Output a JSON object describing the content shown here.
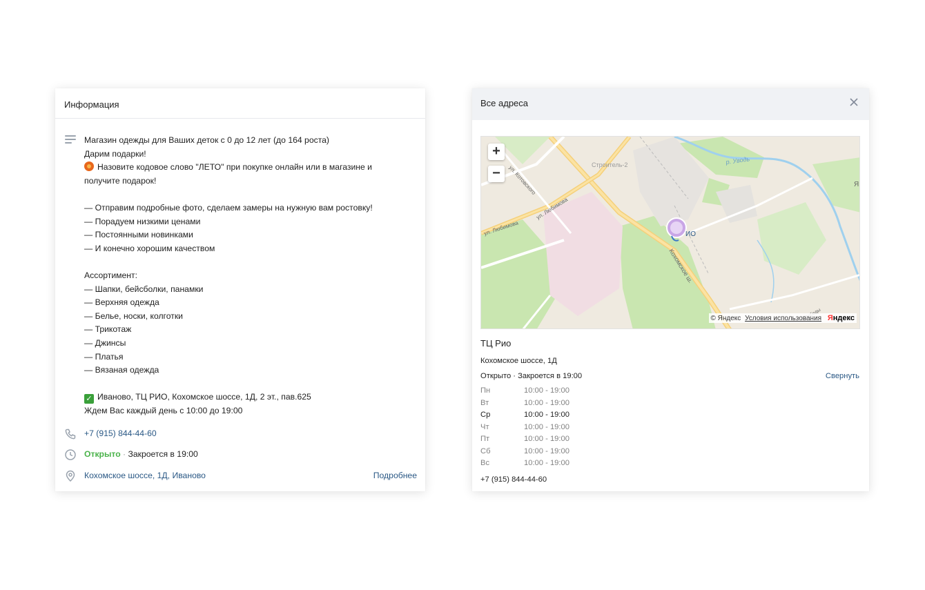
{
  "info": {
    "title": "Информация",
    "description_lines": [
      "Магазин одежды для Ваших деток с 0 до 12 лет (до 164 роста)",
      "Дарим подарки!",
      "Назовите кодовое слово \"ЛЕТО\" при покупке онлайн или в магазине и",
      "получите подарок!",
      "",
      "— Отправим подробные фото, сделаем замеры на нужную вам ростовку!",
      "— Порадуем низкими ценами",
      "— Постоянными новинками",
      "— И конечно хорошим качеством",
      "",
      "Ассортимент:",
      "— Шапки, бейсболки, панамки",
      "— Верхняя одежда",
      "— Белье, носки, колготки",
      "— Трикотаж",
      "— Джинсы",
      "— Платья",
      "— Вязаная одежда",
      "",
      "Иваново, ТЦ РИО, Кохомское шоссе, 1Д, 2 эт., пав.625",
      "Ждем Вас каждый день с 10:00 до 19:00"
    ],
    "phone": "+7 (915) 844-44-60",
    "status_open": "Открыто",
    "status_sep": "·",
    "status_close": "Закроется в 19:00",
    "address": "Кохомское шоссе, 1Д, Иваново",
    "more_label": "Подробнее"
  },
  "addresses": {
    "title": "Все адреса",
    "map": {
      "zoom_in": "+",
      "zoom_out": "−",
      "labels": {
        "stroitel": "Строитель-2",
        "uvod": "р. Уводь",
        "kotovskogo": "ул. Котовского",
        "lyubimova1": "ул. Любимова",
        "lyubimova2": "ул. Любимова",
        "kokhomskoe": "Кохомское ш.",
        "pobedy": "Победы",
        "rio": "ИО",
        "ya": "Я"
      },
      "copyright": "© Яндекс",
      "terms": "Условия использования",
      "brand_red": "Я",
      "brand_black": "ндекс"
    },
    "place": {
      "name": "ТЦ Рио",
      "address": "Кохомское шоссе, 1Д",
      "status": "Открыто · Закроется в 19:00",
      "collapse_label": "Свернуть",
      "schedule": [
        {
          "day": "Пн",
          "hours": "10:00 - 19:00"
        },
        {
          "day": "Вт",
          "hours": "10:00 - 19:00"
        },
        {
          "day": "Ср",
          "hours": "10:00 - 19:00"
        },
        {
          "day": "Чт",
          "hours": "10:00 - 19:00"
        },
        {
          "day": "Пт",
          "hours": "10:00 - 19:00"
        },
        {
          "day": "Сб",
          "hours": "10:00 - 19:00"
        },
        {
          "day": "Вс",
          "hours": "10:00 - 19:00"
        }
      ],
      "phone": "+7 (915) 844-44-60"
    }
  },
  "colors": {
    "link": "#2a5885",
    "open": "#4bb34b",
    "header_bg": "#f0f2f5"
  }
}
